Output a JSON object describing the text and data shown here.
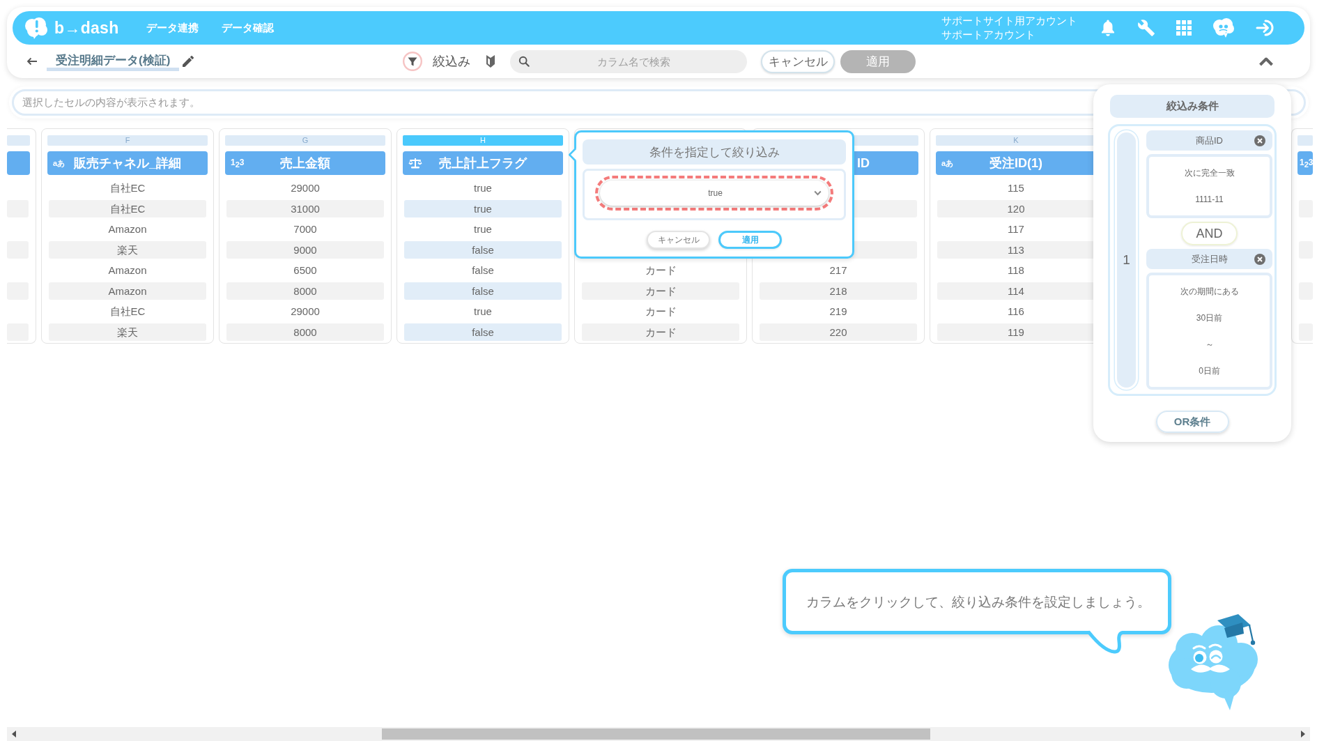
{
  "header": {
    "logo": "b→dash",
    "nav": [
      "データ連携",
      "データ確認"
    ],
    "account": {
      "site": "サポートサイト用アカウント",
      "name": "サポートアカウント"
    }
  },
  "toolbar": {
    "title": "受注明細データ(検証)",
    "filter_label": "絞込み",
    "search": {
      "placeholder": "カラム名で検索"
    },
    "buttons": [
      {
        "label": "キャンセル",
        "disabled": false
      },
      {
        "label": "適用",
        "disabled": true
      }
    ]
  },
  "cell_viewer": {
    "placeholder": "選択したセルの内容が表示されます。"
  },
  "table": {
    "columns": [
      {
        "kind": "stub",
        "selected": false
      },
      {
        "kind": "full",
        "letter": "F",
        "badge": {
          "kind": "string",
          "label": "aあ"
        },
        "name": "販売チャネル_詳細",
        "selected": false,
        "cells": [
          "自社EC",
          "自社EC",
          "Amazon",
          "楽天",
          "Amazon",
          "Amazon",
          "自社EC",
          "楽天"
        ]
      },
      {
        "kind": "full",
        "letter": "G",
        "badge": {
          "kind": "number",
          "label": "1$_{2}$3"
        },
        "name": "売上金額",
        "selected": false,
        "cells": [
          "29000",
          "31000",
          "7000",
          "9000",
          "6500",
          "8000",
          "29000",
          "8000"
        ]
      },
      {
        "kind": "full",
        "letter": "H",
        "badge": {
          "kind": "boolean"
        },
        "name": "売上計上フラグ",
        "selected": true,
        "cells": [
          "true",
          "true",
          "true",
          "false",
          "false",
          "false",
          "true",
          "false"
        ]
      },
      {
        "kind": "covered",
        "selected": false,
        "cells": [
          null,
          null,
          null,
          null,
          "カード",
          "カード",
          "カード",
          "カード"
        ]
      },
      {
        "kind": "covered",
        "name": "ID",
        "selected": false,
        "cells": [
          null,
          null,
          null,
          null,
          "217",
          "218",
          "219",
          "220"
        ]
      },
      {
        "kind": "full",
        "letter": "K",
        "badge": {
          "kind": "string",
          "label": "aあ"
        },
        "name": "受注ID(1)",
        "selected": false,
        "cells": [
          "115",
          "120",
          "117",
          "113",
          "118",
          "114",
          "116",
          "119"
        ]
      },
      {
        "kind": "stub",
        "badge": {
          "kind": "number",
          "label": "1$_{2}$3"
        },
        "selected": false
      }
    ]
  },
  "filter_popup": {
    "title": "条件を指定して絞り込み",
    "select": {
      "value": "true",
      "highlighted": true
    },
    "buttons": [
      {
        "label": "キャンセル",
        "primary": false
      },
      {
        "label": "適用",
        "primary": true
      }
    ]
  },
  "conditions_panel": {
    "title": "絞込み条件",
    "groups": [
      {
        "label": "1",
        "connector": "AND",
        "conditions": [
          {
            "column": "商品ID",
            "lines": [
              "次に完全一致",
              "1111-11"
            ]
          },
          {
            "column": "受注日時",
            "lines": [
              "次の期間にある",
              "30日前",
              "～",
              "0日前"
            ]
          }
        ]
      }
    ],
    "or_button": "OR条件"
  },
  "tutorial": {
    "message": "カラムをクリックして、絞り込み条件を設定しましょう。"
  }
}
